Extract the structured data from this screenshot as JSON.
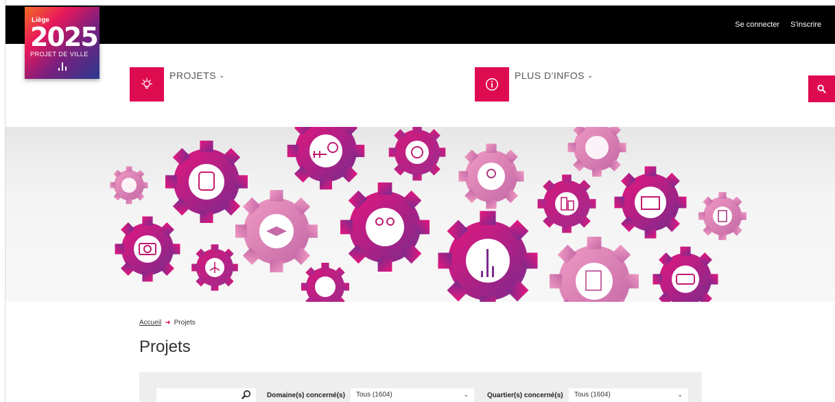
{
  "header": {
    "login_label": "Se connecter",
    "register_label": "S'inscrire"
  },
  "logo": {
    "city": "Liège",
    "year": "2025",
    "subtitle": "PROJET DE VILLE"
  },
  "nav": {
    "projects_label": "PROJETS",
    "more_info_label": "PLUS D'INFOS"
  },
  "breadcrumb": {
    "home": "Accueil",
    "current": "Projets"
  },
  "page": {
    "title": "Projets"
  },
  "filters": {
    "search_value": "",
    "domain_label": "Domaine(s) concerné(s)",
    "domain_value": "Tous (1604)",
    "quarter_label": "Quartier(s) concerné(s)",
    "quarter_value": "Tous (1604)"
  },
  "colors": {
    "accent": "#df0b50",
    "topbar": "#000000"
  }
}
